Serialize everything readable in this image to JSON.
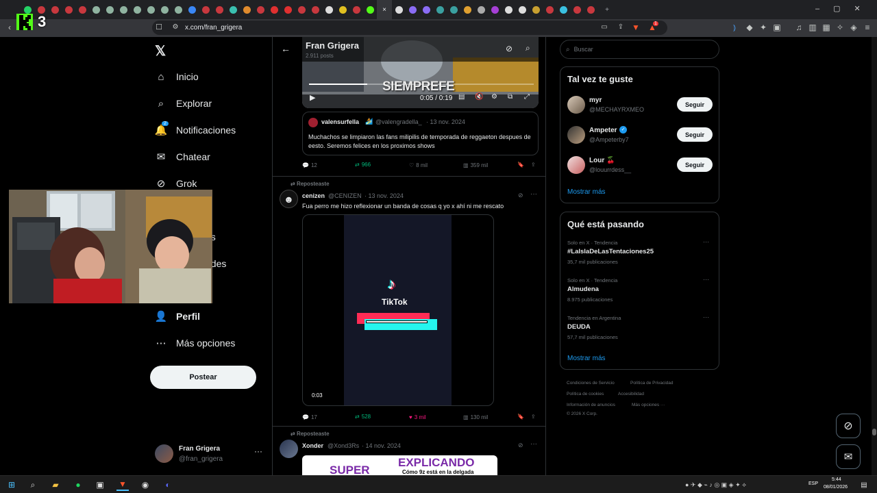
{
  "browser": {
    "url": "x.com/fran_grigera",
    "tabs_close_glyph": "×",
    "new_tab_glyph": "+",
    "brave_badge": "1"
  },
  "overlay": {
    "logo_number": "3"
  },
  "sidebar": {
    "items": [
      {
        "label": "Inicio",
        "icon": "home-icon"
      },
      {
        "label": "Explorar",
        "icon": "search-icon"
      },
      {
        "label": "Notificaciones",
        "icon": "bell-icon",
        "badge": "2"
      },
      {
        "label": "Chatear",
        "icon": "mail-icon"
      },
      {
        "label": "Grok",
        "icon": "grok-icon"
      },
      {
        "label": "os",
        "icon": ""
      },
      {
        "label": "ades",
        "icon": ""
      },
      {
        "label": "Perfil",
        "icon": "person-icon"
      },
      {
        "label": "Más opciones",
        "icon": "more-circle-icon"
      }
    ],
    "post_button": "Postear",
    "account": {
      "name": "Fran Grigera",
      "handle": "@fran_grigera"
    }
  },
  "header": {
    "name": "Fran Grigera",
    "posts": "2.911 posts"
  },
  "video1": {
    "watermark": "SIEMPREFE",
    "time": "0:05 / 0:19"
  },
  "quote": {
    "name": "valensurfella",
    "handle": "@valengradella_",
    "date": "· 13 nov. 2024",
    "text": "Muchachos se limpiaron las fans milipilis de temporada de reggaeton despues de eesto. Seremos felices en los proximos shows"
  },
  "tweet0_actions": {
    "replies": "12",
    "reposts": "966",
    "likes": "8 mil",
    "views": "359 mil"
  },
  "tweet1": {
    "repost_label": "Reposteaste",
    "name": "cenizen",
    "handle": "@CENIZEN",
    "date": "· 13 nov. 2024",
    "text": "Fua perro me hizo reflexionar un banda de cosas q yo x ahí ni me rescato",
    "video_brand": "TikTok",
    "video_time": "0:03",
    "replies": "17",
    "reposts": "528",
    "likes": "3 mil",
    "views": "130 mil"
  },
  "tweet2": {
    "repost_label": "Reposteaste",
    "name": "Xonder",
    "handle": "@Xond3Rs",
    "date": "· 14 nov. 2024",
    "image_text_left": "SUPER",
    "image_text_right": "EXPLICANDO",
    "image_subtext": "Cómo 9z está en la delgada"
  },
  "search": {
    "placeholder": "Buscar"
  },
  "suggestions": {
    "title": "Tal vez te guste",
    "users": [
      {
        "name": "myr",
        "handle": "@MECHAYRXMEO",
        "button": "Seguir"
      },
      {
        "name": "Ampeter",
        "handle": "@Ampeterby7",
        "button": "Seguir"
      },
      {
        "name": "Lour 🍒",
        "handle": "@louurrdess__",
        "button": "Seguir"
      }
    ],
    "more": "Mostrar más"
  },
  "trends": {
    "title": "Qué está pasando",
    "items": [
      {
        "context": "Solo en X · Tendencia",
        "name": "#LaIslaDeLasTentaciones25",
        "count": "35,7 mil publicaciones"
      },
      {
        "context": "Solo en X · Tendencia",
        "name": "Almudena",
        "count": "8.975 publicaciones"
      },
      {
        "context": "Tendencia en Argentina",
        "name": "DEUDA",
        "count": "57,7 mil publicaciones"
      }
    ],
    "more": "Mostrar más"
  },
  "footer": {
    "links": [
      "Condiciones de Servicio",
      "Política de Privacidad",
      "Política de cookies",
      "Accesibilidad",
      "Información de anuncios",
      "Más opciones ···"
    ],
    "copyright": "© 2026 X Corp."
  },
  "taskbar": {
    "lang": "ESP",
    "time": "5:44",
    "date": "08/01/2026"
  },
  "colors": {
    "accent": "#1d9bf0",
    "repost": "#00ba7c",
    "like": "#f91880",
    "background": "#000000",
    "border": "#2f3336"
  }
}
